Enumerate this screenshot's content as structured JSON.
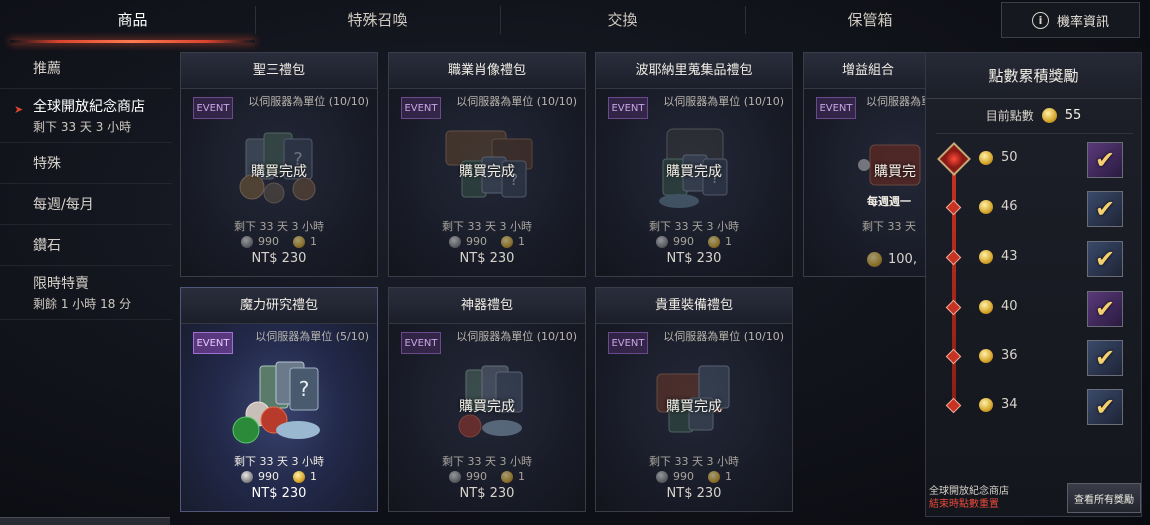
{
  "nav": {
    "tabs": [
      {
        "label": "商品"
      },
      {
        "label": "特殊召喚"
      },
      {
        "label": "交換"
      },
      {
        "label": "保管箱"
      }
    ],
    "rate_info_label": "機率資訊"
  },
  "sidebar": {
    "items": [
      {
        "label": "推薦",
        "sub": ""
      },
      {
        "label": "全球開放紀念商店",
        "sub": "剩下 33 天 3 小時"
      },
      {
        "label": "特殊",
        "sub": ""
      },
      {
        "label": "每週/每月",
        "sub": ""
      },
      {
        "label": "鑽石",
        "sub": ""
      },
      {
        "label": "限時特賣",
        "sub": "剩餘 1 小時 18 分"
      }
    ]
  },
  "products": [
    {
      "title": "聖三禮包",
      "badge": "EVENT",
      "limit": "以伺服器為單位 (10/10)",
      "status": "購買完成",
      "time": "剩下 33 天 3 小時",
      "token": "990",
      "coin": "1",
      "price": "NT$ 230"
    },
    {
      "title": "職業肖像禮包",
      "badge": "EVENT",
      "limit": "以伺服器為單位 (10/10)",
      "status": "購買完成",
      "time": "剩下 33 天 3 小時",
      "token": "990",
      "coin": "1",
      "price": "NT$ 230"
    },
    {
      "title": "波耶納里蒐集品禮包",
      "badge": "EVENT",
      "limit": "以伺服器為單位 (10/10)",
      "status": "購買完成",
      "time": "剩下 33 天 3 小時",
      "token": "990",
      "coin": "1",
      "price": "NT$ 230"
    },
    {
      "title": "增益組合",
      "badge": "EVENT",
      "limit": "以伺服器為單位",
      "status": "購買完",
      "note": "每週週一",
      "time": "剩下 33 天",
      "token": "100,",
      "price": ""
    },
    {
      "title": "魔力研究禮包",
      "badge": "EVENT",
      "limit": "以伺服器為單位 (5/10)",
      "status": "",
      "time": "剩下 33 天 3 小時",
      "token": "990",
      "coin": "1",
      "price": "NT$ 230"
    },
    {
      "title": "神器禮包",
      "badge": "EVENT",
      "limit": "以伺服器為單位 (10/10)",
      "status": "購買完成",
      "time": "剩下 33 天 3 小時",
      "token": "990",
      "coin": "1",
      "price": "NT$ 230"
    },
    {
      "title": "貴重裝備禮包",
      "badge": "EVENT",
      "limit": "以伺服器為單位 (10/10)",
      "status": "購買完成",
      "time": "剩下 33 天 3 小時",
      "token": "990",
      "coin": "1",
      "price": "NT$ 230"
    }
  ],
  "reward_panel": {
    "title": "點數累積獎勵",
    "current_label": "目前點數",
    "current_points": "55",
    "tiers": [
      {
        "points": "50",
        "claimed": true,
        "box": "purple"
      },
      {
        "points": "46",
        "claimed": true,
        "box": "blue"
      },
      {
        "points": "43",
        "claimed": true,
        "box": "blue"
      },
      {
        "points": "40",
        "claimed": true,
        "box": "purple"
      },
      {
        "points": "36",
        "claimed": true,
        "box": "blue"
      },
      {
        "points": "34",
        "claimed": true,
        "box": "blue"
      }
    ],
    "note_line1": "全球開放紀念商店",
    "note_line2": "結束時點數重置",
    "view_all_label": "查看所有獎勵"
  }
}
